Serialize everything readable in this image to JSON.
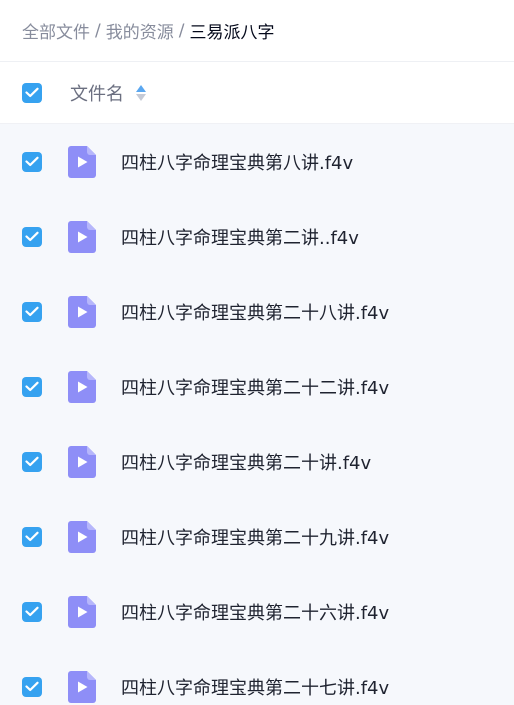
{
  "breadcrumb": {
    "items": [
      "全部文件",
      "我的资源"
    ],
    "separator": "/",
    "current": "三易派八字"
  },
  "header": {
    "select_all_checked": true,
    "column_label": "文件名",
    "sort_icon": "sort-arrows-icon"
  },
  "files": [
    {
      "name": "四柱八字命理宝典第八讲.f4v",
      "checked": true,
      "icon": "video-file-icon"
    },
    {
      "name": "四柱八字命理宝典第二讲..f4v",
      "checked": true,
      "icon": "video-file-icon"
    },
    {
      "name": "四柱八字命理宝典第二十八讲.f4v",
      "checked": true,
      "icon": "video-file-icon"
    },
    {
      "name": "四柱八字命理宝典第二十二讲.f4v",
      "checked": true,
      "icon": "video-file-icon"
    },
    {
      "name": "四柱八字命理宝典第二十讲.f4v",
      "checked": true,
      "icon": "video-file-icon"
    },
    {
      "name": "四柱八字命理宝典第二十九讲.f4v",
      "checked": true,
      "icon": "video-file-icon"
    },
    {
      "name": "四柱八字命理宝典第二十六讲.f4v",
      "checked": true,
      "icon": "video-file-icon"
    },
    {
      "name": "四柱八字命理宝典第二十七讲.f4v",
      "checked": true,
      "icon": "video-file-icon"
    }
  ],
  "colors": {
    "checkbox": "#36a2f0",
    "file_icon": "#8e8ef7",
    "list_background": "#f6f8fc"
  }
}
